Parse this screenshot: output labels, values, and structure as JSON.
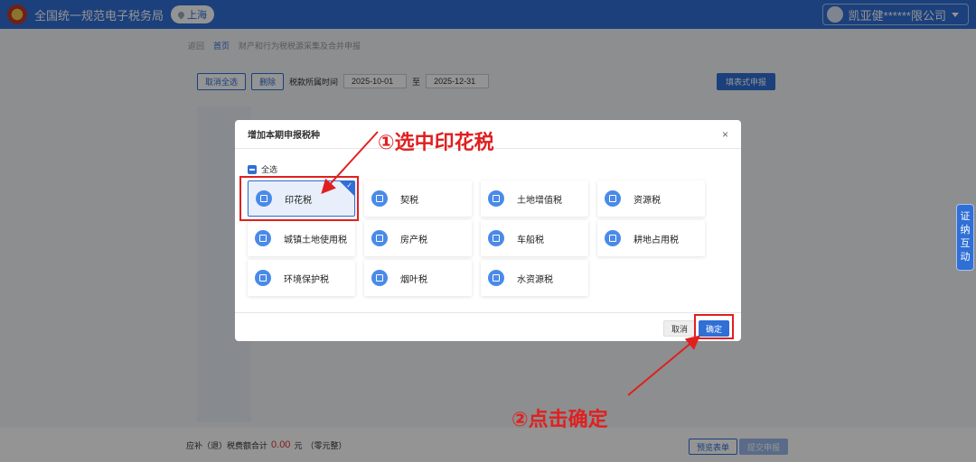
{
  "header": {
    "title": "全国统一规范电子税务局",
    "region": "上海",
    "company": "凯亚健******限公司"
  },
  "breadcrumb": {
    "back": "返回",
    "home": "首页",
    "current": "财产和行为税税源采集及合并申报"
  },
  "toolbar": {
    "cancel_all": "取消全选",
    "delete": "删除",
    "period_label": "税款所属时间",
    "date_start": "2025-10-01",
    "date_to": "至",
    "date_end": "2025-12-31",
    "fill_form": "填表式申报"
  },
  "footer": {
    "total_label": "应补（退）税费额合计",
    "amount": "0.00",
    "unit": "元",
    "amount_words": "（零元整）",
    "preview_button": "预览表单",
    "submit_button": "提交申报"
  },
  "modal": {
    "title": "增加本期申报税种",
    "close": "×",
    "select_all": "全选",
    "tax_types": [
      {
        "label": "印花税",
        "selected": true,
        "icon": "stamp-icon"
      },
      {
        "label": "契税",
        "selected": false,
        "icon": "document-icon"
      },
      {
        "label": "土地增值税",
        "selected": false,
        "icon": "land-icon"
      },
      {
        "label": "资源税",
        "selected": false,
        "icon": "resource-icon"
      },
      {
        "label": "城镇土地使用税",
        "selected": false,
        "icon": "building-icon"
      },
      {
        "label": "房产税",
        "selected": false,
        "icon": "house-icon"
      },
      {
        "label": "车船税",
        "selected": false,
        "icon": "vehicle-icon"
      },
      {
        "label": "耕地占用税",
        "selected": false,
        "icon": "farmland-icon"
      },
      {
        "label": "环境保护税",
        "selected": false,
        "icon": "environment-icon"
      },
      {
        "label": "烟叶税",
        "selected": false,
        "icon": "tobacco-icon"
      },
      {
        "label": "水资源税",
        "selected": false,
        "icon": "water-icon"
      }
    ],
    "cancel_button": "取消",
    "ok_button": "确定"
  },
  "annotations": {
    "step1": "①选中印花税",
    "step2": "②点击确定",
    "color": "#e02020"
  },
  "side_tab": {
    "label_lines": [
      "证",
      "纳",
      "互",
      "动"
    ]
  }
}
